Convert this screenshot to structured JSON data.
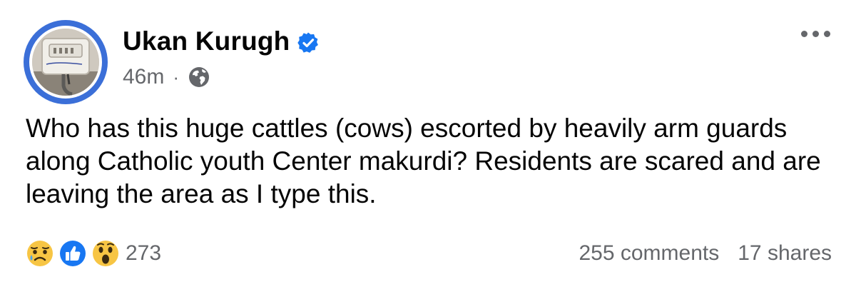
{
  "post": {
    "author": "Ukan Kurugh",
    "verified": true,
    "time": "46m",
    "separator": "·",
    "audience_icon": "globe-icon",
    "text": "Who has this huge cattles (cows) escorted by heavily arm guards along Catholic youth Center makurdi? Residents are scared and are leaving the area as I type this.",
    "reactions": {
      "icons": [
        "sad-reaction-icon",
        "like-reaction-icon",
        "wow-reaction-icon"
      ],
      "count": "273"
    },
    "comments": "255 comments",
    "shares": "17 shares"
  },
  "colors": {
    "verified": "#1877f2",
    "avatar_ring": "#3b6fd8",
    "secondary_text": "#65676b",
    "primary_text": "#050505"
  }
}
